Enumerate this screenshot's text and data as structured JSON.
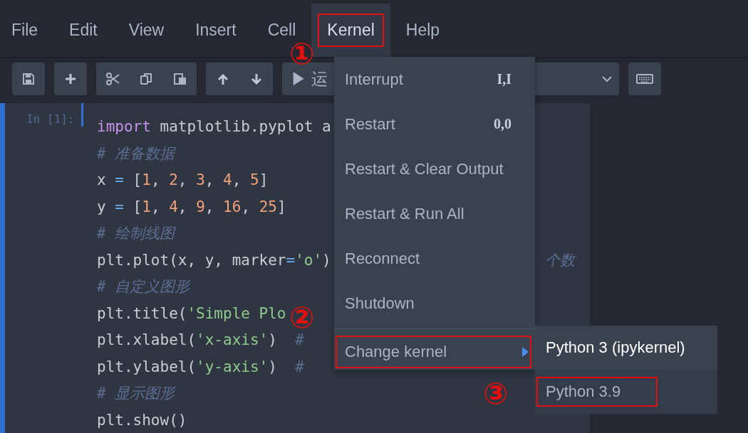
{
  "menubar": [
    {
      "label": "File",
      "selected": false,
      "boxed": false
    },
    {
      "label": "Edit",
      "selected": false,
      "boxed": false
    },
    {
      "label": "View",
      "selected": false,
      "boxed": false
    },
    {
      "label": "Insert",
      "selected": false,
      "boxed": false
    },
    {
      "label": "Cell",
      "selected": false,
      "boxed": false
    },
    {
      "label": "Kernel",
      "selected": true,
      "boxed": true
    },
    {
      "label": "Help",
      "selected": false,
      "boxed": false
    }
  ],
  "toolbar": {
    "run_button": "▶ 运"
  },
  "cell": {
    "prompt": "In [1]:",
    "lines": [
      [
        {
          "kind": "kw",
          "t": "import"
        },
        {
          "kind": "plain",
          "t": " matplotlib.pyplot a"
        }
      ],
      [
        {
          "kind": "comment",
          "t": "# 准备数据"
        }
      ],
      [
        {
          "kind": "plain",
          "t": "x "
        },
        {
          "kind": "op",
          "t": "="
        },
        {
          "kind": "plain",
          "t": " ["
        },
        {
          "kind": "num",
          "t": "1"
        },
        {
          "kind": "plain",
          "t": ", "
        },
        {
          "kind": "num",
          "t": "2"
        },
        {
          "kind": "plain",
          "t": ", "
        },
        {
          "kind": "num",
          "t": "3"
        },
        {
          "kind": "plain",
          "t": ", "
        },
        {
          "kind": "num",
          "t": "4"
        },
        {
          "kind": "plain",
          "t": ", "
        },
        {
          "kind": "num",
          "t": "5"
        },
        {
          "kind": "plain",
          "t": "]"
        }
      ],
      [
        {
          "kind": "plain",
          "t": "y "
        },
        {
          "kind": "op",
          "t": "="
        },
        {
          "kind": "plain",
          "t": " ["
        },
        {
          "kind": "num",
          "t": "1"
        },
        {
          "kind": "plain",
          "t": ", "
        },
        {
          "kind": "num",
          "t": "4"
        },
        {
          "kind": "plain",
          "t": ", "
        },
        {
          "kind": "num",
          "t": "9"
        },
        {
          "kind": "plain",
          "t": ", "
        },
        {
          "kind": "num",
          "t": "16"
        },
        {
          "kind": "plain",
          "t": ", "
        },
        {
          "kind": "num",
          "t": "25"
        },
        {
          "kind": "plain",
          "t": "]"
        }
      ],
      [
        {
          "kind": "comment",
          "t": "# 绘制线图"
        }
      ],
      [
        {
          "kind": "plain",
          "t": "plt.plot(x, y, marker"
        },
        {
          "kind": "op",
          "t": "="
        },
        {
          "kind": "str",
          "t": "'o'"
        },
        {
          "kind": "plain",
          "t": ")"
        },
        {
          "kind": "tail",
          "t": "个数"
        }
      ],
      [
        {
          "kind": "comment",
          "t": "# 自定义图形"
        }
      ],
      [
        {
          "kind": "plain",
          "t": "plt.title("
        },
        {
          "kind": "str",
          "t": "'Simple Plo"
        }
      ],
      [
        {
          "kind": "plain",
          "t": "plt.xlabel("
        },
        {
          "kind": "str",
          "t": "'x-axis'"
        },
        {
          "kind": "plain",
          "t": ")  "
        },
        {
          "kind": "comment",
          "t": "#"
        }
      ],
      [
        {
          "kind": "plain",
          "t": "plt.ylabel("
        },
        {
          "kind": "str",
          "t": "'y-axis'"
        },
        {
          "kind": "plain",
          "t": ")  "
        },
        {
          "kind": "comment",
          "t": "#"
        }
      ],
      [
        {
          "kind": "comment",
          "t": "# 显示图形"
        }
      ],
      [
        {
          "kind": "plain",
          "t": "plt.show()"
        }
      ]
    ]
  },
  "kernel_menu": {
    "items": [
      {
        "label": "Interrupt",
        "shortcut": "I,I",
        "kind": "item",
        "boxed": false
      },
      {
        "label": "Restart",
        "shortcut": "0,0",
        "kind": "item",
        "boxed": false
      },
      {
        "label": "Restart & Clear Output",
        "kind": "item",
        "boxed": false
      },
      {
        "label": "Restart & Run All",
        "kind": "item",
        "boxed": false
      },
      {
        "label": "Reconnect",
        "kind": "item",
        "boxed": false
      },
      {
        "label": "Shutdown",
        "kind": "item",
        "boxed": false
      },
      {
        "label": "Change kernel",
        "kind": "submenu",
        "boxed": true
      }
    ],
    "submenu": [
      {
        "label": "Python 3 (ipykernel)",
        "selected": true,
        "boxed": false
      },
      {
        "label": "Python 3.9",
        "selected": false,
        "boxed": true
      }
    ]
  },
  "annotations": [
    "①",
    "②",
    "③"
  ]
}
